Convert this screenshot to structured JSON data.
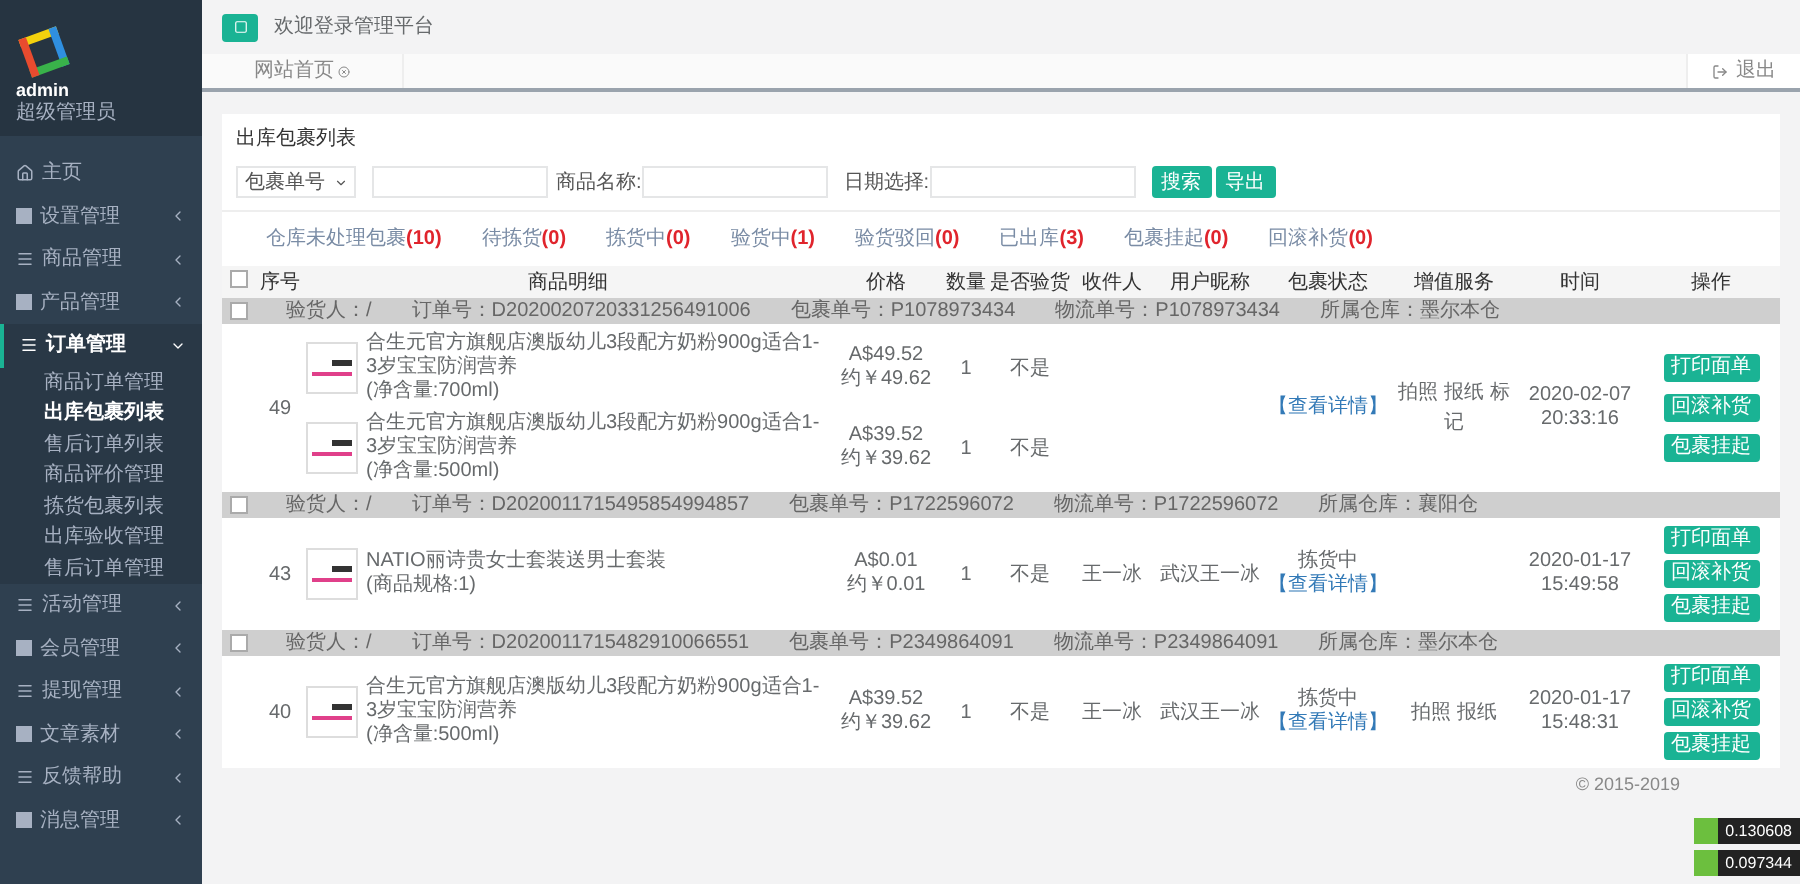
{
  "sidebar": {
    "user": {
      "name": "admin",
      "role": "超级管理员"
    },
    "items": [
      {
        "label": "主页",
        "kind": "home"
      },
      {
        "label": "设置管理",
        "kind": "square",
        "expanded": false
      },
      {
        "label": "商品管理",
        "kind": "list",
        "expanded": false
      },
      {
        "label": "产品管理",
        "kind": "square",
        "expanded": false
      },
      {
        "label": "订单管理",
        "kind": "list",
        "expanded": true,
        "children": [
          {
            "label": "商品订单管理",
            "selected": false
          },
          {
            "label": "出库包裹列表",
            "selected": true
          },
          {
            "label": "售后订单列表",
            "selected": false
          },
          {
            "label": "商品评价管理",
            "selected": false
          },
          {
            "label": "拣货包裹列表",
            "selected": false
          },
          {
            "label": "出库验收管理",
            "selected": false
          },
          {
            "label": "售后订单管理",
            "selected": false
          }
        ]
      },
      {
        "label": "活动管理",
        "kind": "list",
        "expanded": false
      },
      {
        "label": "会员管理",
        "kind": "square",
        "expanded": false
      },
      {
        "label": "提现管理",
        "kind": "list",
        "expanded": false
      },
      {
        "label": "文章素材",
        "kind": "square",
        "expanded": false
      },
      {
        "label": "反馈帮助",
        "kind": "list",
        "expanded": false
      },
      {
        "label": "消息管理",
        "kind": "square",
        "expanded": false
      }
    ]
  },
  "header": {
    "welcome": "欢迎登录管理平台",
    "tab": "网站首页",
    "logout": "退出"
  },
  "card": {
    "title": "出库包裹列表",
    "filters": {
      "select": "包裹单号",
      "name_label": "商品名称:",
      "date_label": "日期选择:",
      "buttons": [
        "搜索",
        "导出"
      ]
    },
    "status_tabs": [
      {
        "label": "仓库未处理包裹",
        "count": "(10)"
      },
      {
        "label": "待拣货",
        "count": "(0)"
      },
      {
        "label": "拣货中",
        "count": "(0)"
      },
      {
        "label": "验货中",
        "count": "(1)"
      },
      {
        "label": "验货驳回",
        "count": "(0)"
      },
      {
        "label": "已出库",
        "count": "(3)"
      },
      {
        "label": "包裹挂起",
        "count": "(0)"
      },
      {
        "label": "回滚补货",
        "count": "(0)"
      }
    ],
    "columns": [
      "序号",
      "商品明细",
      "价格",
      "数量",
      "是否验货",
      "收件人",
      "用户昵称",
      "包裹状态",
      "增值服务",
      "时间",
      "操作"
    ],
    "header_checked": false,
    "rows": [
      {
        "checked": false,
        "inspector": "验货人：/",
        "order": "订单号：D2020020720331256491006",
        "package": "包裹单号：P1078973434",
        "logistics": "物流单号：P1078973434",
        "warehouse": "所属仓库：墨尔本仓",
        "seq": "49",
        "products": [
          {
            "title": "合生元官方旗舰店澳版幼儿3段配方奶粉900g适合1-3岁宝宝防润营养",
            "spec": "(净含量:700ml)",
            "price": "A$49.52",
            "cny": "约￥49.62",
            "qty": "1",
            "inspected": "不是"
          },
          {
            "title": "合生元官方旗舰店澳版幼儿3段配方奶粉900g适合1-3岁宝宝防润营养",
            "spec": "(净含量:500ml)",
            "price": "A$39.52",
            "cny": "约￥39.62",
            "qty": "1",
            "inspected": "不是"
          }
        ],
        "details": "【查看详情】",
        "services": "拍照 报纸 标记",
        "time": "2020-02-07 20:33:16",
        "actions": [
          "打印面单",
          "回滚补货",
          "包裹挂起"
        ]
      },
      {
        "checked": false,
        "inspector": "验货人：/",
        "order": "订单号：D2020011715495854994857",
        "package": "包裹单号：P1722596072",
        "logistics": "物流单号：P1722596072",
        "warehouse": "所属仓库：襄阳仓",
        "seq": "43",
        "products": [
          {
            "title": "NATIO丽诗贵女士套装送男士套装",
            "spec": "(商品规格:1)",
            "price": "A$0.01",
            "cny": "约￥0.01",
            "qty": "1",
            "inspected": "不是"
          }
        ],
        "receiver": "王一冰",
        "nickname": "武汉王一冰",
        "status": "拣货中",
        "details": "【查看详情】",
        "time": "2020-01-17 15:49:58",
        "actions": [
          "打印面单",
          "回滚补货",
          "包裹挂起"
        ]
      },
      {
        "checked": false,
        "inspector": "验货人：/",
        "order": "订单号：D2020011715482910066551",
        "package": "包裹单号：P2349864091",
        "logistics": "物流单号：P2349864091",
        "warehouse": "所属仓库：墨尔本仓",
        "seq": "40",
        "products": [
          {
            "title": "合生元官方旗舰店澳版幼儿3段配方奶粉900g适合1-3岁宝宝防润营养",
            "spec": "(净含量:500ml)",
            "price": "A$39.52",
            "cny": "约￥39.62",
            "qty": "1",
            "inspected": "不是"
          }
        ],
        "receiver": "王一冰",
        "nickname": "武汉王一冰",
        "status": "拣货中",
        "details": "【查看详情】",
        "services": "拍照 报纸",
        "time": "2020-01-17 15:48:31",
        "actions": [
          "打印面单",
          "回滚补货",
          "包裹挂起"
        ]
      }
    ]
  },
  "footer": "© 2015-2019",
  "overlay_badges": [
    "0.130608",
    "0.097344"
  ]
}
